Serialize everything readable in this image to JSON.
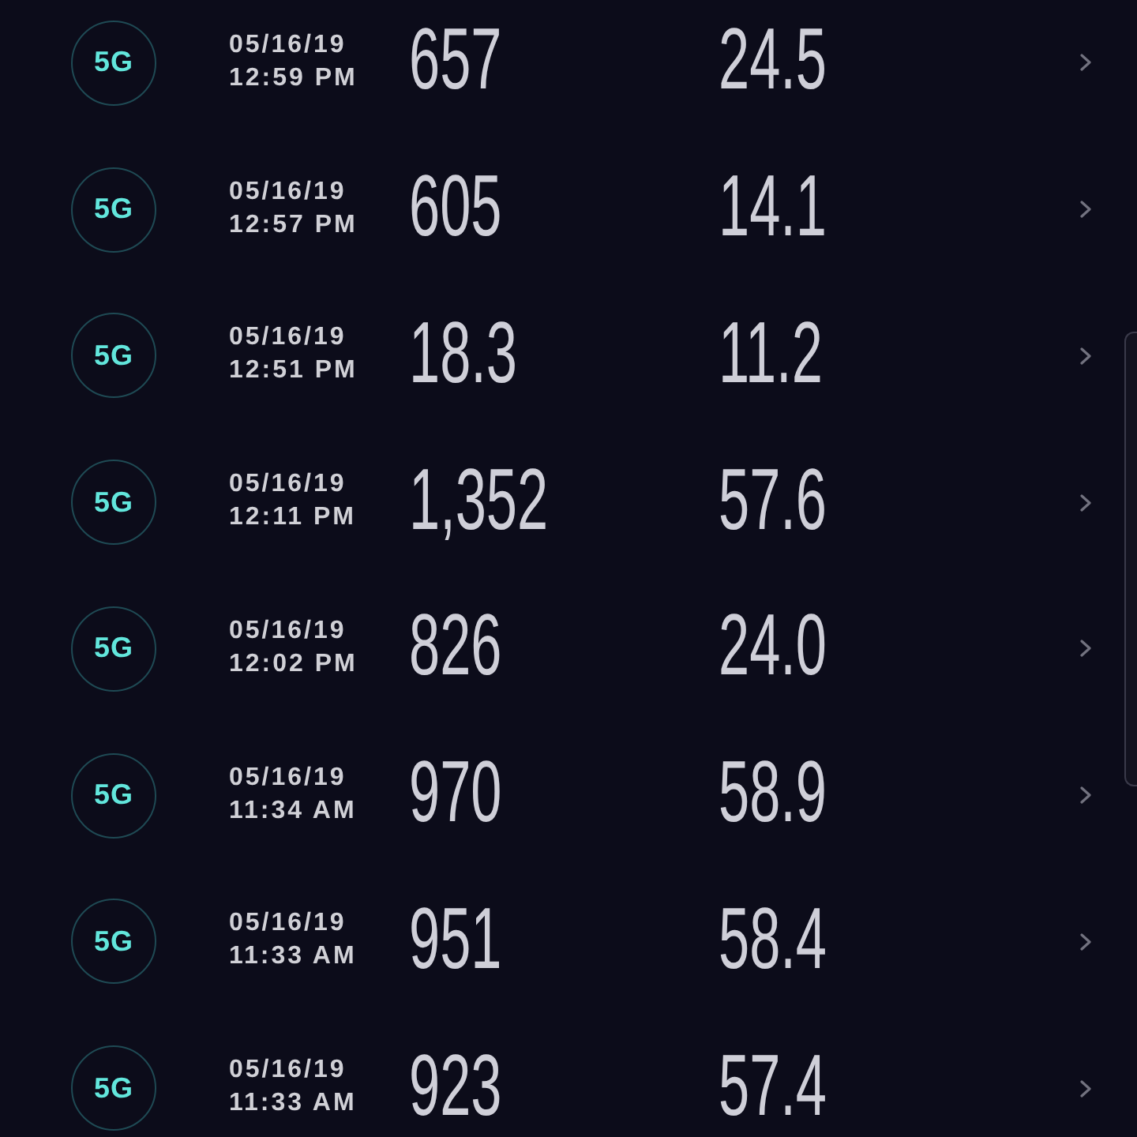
{
  "results": [
    {
      "network": "5G",
      "date": "05/16/19",
      "time": "12:59 PM",
      "download": "657",
      "upload": "24.5"
    },
    {
      "network": "5G",
      "date": "05/16/19",
      "time": "12:57 PM",
      "download": "605",
      "upload": "14.1"
    },
    {
      "network": "5G",
      "date": "05/16/19",
      "time": "12:51 PM",
      "download": "18.3",
      "upload": "11.2"
    },
    {
      "network": "5G",
      "date": "05/16/19",
      "time": "12:11 PM",
      "download": "1,352",
      "upload": "57.6"
    },
    {
      "network": "5G",
      "date": "05/16/19",
      "time": "12:02 PM",
      "download": "826",
      "upload": "24.0"
    },
    {
      "network": "5G",
      "date": "05/16/19",
      "time": "11:34 AM",
      "download": "970",
      "upload": "58.9"
    },
    {
      "network": "5G",
      "date": "05/16/19",
      "time": "11:33 AM",
      "download": "951",
      "upload": "58.4"
    },
    {
      "network": "5G",
      "date": "05/16/19",
      "time": "11:33 AM",
      "download": "923",
      "upload": "57.4"
    }
  ]
}
